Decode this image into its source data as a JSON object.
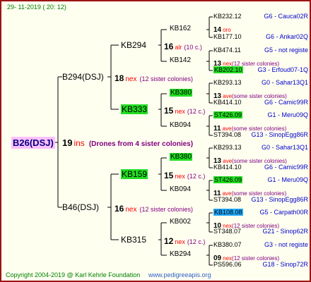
{
  "date": "29- 11-2019 ( 20: 12)",
  "footer": {
    "copyright": "Copyright 2004-2019 @ Karl Kehrle Foundation",
    "website": "www.pedigreeapis.org"
  },
  "colors": {
    "border": "#9b1414",
    "background": "#fffff0",
    "root_highlight": "#ffc0ff",
    "green_highlight": "#22dd22",
    "blue_highlight": "#22aaff",
    "lines": "#000000",
    "red_text": "#ff0000",
    "purple_text": "#800080",
    "blue_text": "#0000cc",
    "green_text": "#008000"
  },
  "root": {
    "name": "B26(DSJ)",
    "year": "19",
    "breeder_code": "ins",
    "note": "(Drones from 4 sister colonies)"
  },
  "gen1": [
    {
      "name": "B294(DSJ)",
      "year": "18",
      "code": "nex",
      "note": "(12 sister colonies)"
    },
    {
      "name": "B46(DSJ)",
      "year": "16",
      "code": "nex",
      "note": "(12 sister colonies)"
    }
  ],
  "gen2": [
    {
      "name": "KB294",
      "year": "16",
      "code": "alr",
      "note": "(10 c.)",
      "highlight": ""
    },
    {
      "name": "KB333",
      "year": "15",
      "code": "nex",
      "note": "(12 c.)",
      "highlight": "green"
    },
    {
      "name": "KB159",
      "year": "15",
      "code": "nex",
      "note": "(12 c.)",
      "highlight": "green"
    },
    {
      "name": "KB315",
      "year": "12",
      "code": "nex",
      "note": "(12 c.)",
      "highlight": ""
    }
  ],
  "gen3": [
    {
      "name": "KB162",
      "year": "14",
      "code": "oro",
      "note": "",
      "highlight": ""
    },
    {
      "name": "KB142",
      "year": "13",
      "code": "nex",
      "note": "(12 sister colonies)",
      "highlight": ""
    },
    {
      "name": "KB380",
      "year": "13",
      "code": "ave",
      "note": "(some sister colonies)",
      "highlight": "green"
    },
    {
      "name": "KB094",
      "year": "11",
      "code": "ave",
      "note": "(some sister colonies)",
      "highlight": ""
    },
    {
      "name": "KB380",
      "year": "13",
      "code": "ave",
      "note": "(some sister colonies)",
      "highlight": "green"
    },
    {
      "name": "KB094",
      "year": "11",
      "code": "ave",
      "note": "(some sister colonies)",
      "highlight": ""
    },
    {
      "name": "KB002",
      "year": "10",
      "code": "nex",
      "note": "(12 sister colonies)",
      "highlight": ""
    },
    {
      "name": "KB294",
      "year": "09",
      "code": "nex",
      "note": "(12 sister colonies)",
      "highlight": ""
    }
  ],
  "gen4": [
    {
      "name": "KB232.12",
      "ref": "G6 - Cauca02R",
      "highlight": ""
    },
    {
      "name": "KB177.10",
      "ref": "G6 - Ankar02Q",
      "highlight": ""
    },
    {
      "name": "KB474.11",
      "ref": "G5 - not registe",
      "highlight": ""
    },
    {
      "name": "KB202.10",
      "ref": "G3 - Erfoud07-1Q",
      "highlight": "green"
    },
    {
      "name": "KB293.13",
      "ref": "G0 - Sahar13Q1",
      "highlight": ""
    },
    {
      "name": "KB414.10",
      "ref": "G6 - Camic99R",
      "highlight": ""
    },
    {
      "name": "ST426.09",
      "ref": "G1 - Meru09Q",
      "highlight": "green"
    },
    {
      "name": "ST394.08",
      "ref": "G13 - SinopEgg86R",
      "highlight": ""
    },
    {
      "name": "KB293.13",
      "ref": "G0 - Sahar13Q1",
      "highlight": ""
    },
    {
      "name": "KB414.10",
      "ref": "G6 - Camic99R",
      "highlight": ""
    },
    {
      "name": "ST426.09",
      "ref": "G1 - Meru09Q",
      "highlight": "green"
    },
    {
      "name": "ST394.08",
      "ref": "G13 - SinopEgg86R",
      "highlight": ""
    },
    {
      "name": "KB108.08",
      "ref": "G5 - Carpath00R",
      "highlight": "blue"
    },
    {
      "name": "ST348.07",
      "ref": "G21 - Sinop62R",
      "highlight": ""
    },
    {
      "name": "KB380.07",
      "ref": "G3 - not registe",
      "highlight": ""
    },
    {
      "name": "PS596.06",
      "ref": "G18 - Sinop72R",
      "highlight": ""
    }
  ]
}
